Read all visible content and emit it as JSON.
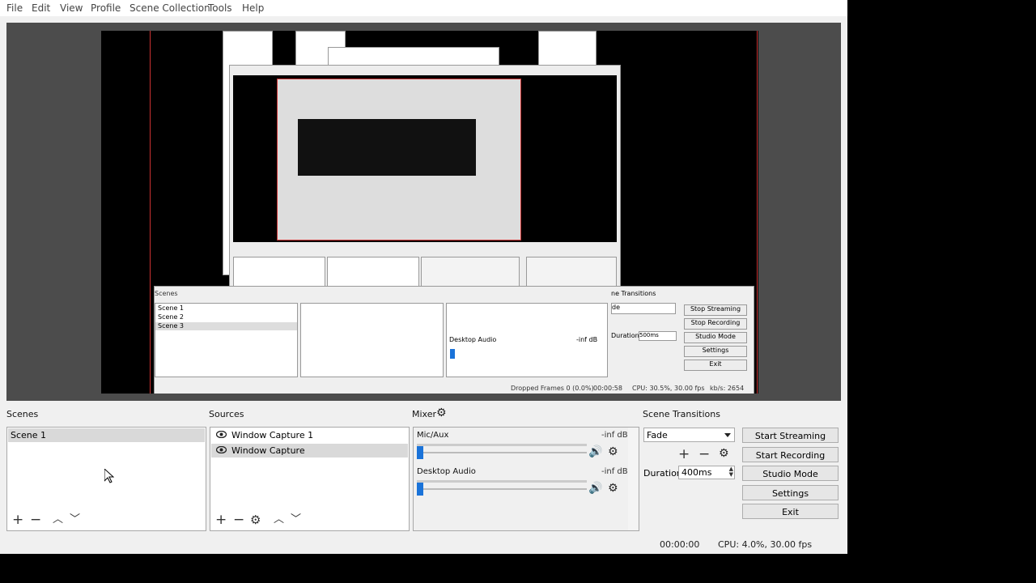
{
  "menu": [
    "File",
    "Edit",
    "View",
    "Profile",
    "Scene Collection",
    "Tools",
    "Help"
  ],
  "scenes": {
    "title": "Scenes",
    "items": [
      "Scene 1"
    ],
    "selected": "Scene 1"
  },
  "sources": {
    "title": "Sources",
    "items": [
      "Window Capture 1",
      "Window Capture"
    ]
  },
  "mixer": {
    "title": "Mixer",
    "channels": [
      {
        "name": "Mic/Aux",
        "db": "-inf dB",
        "level": 0
      },
      {
        "name": "Desktop Audio",
        "db": "-inf dB",
        "level": 0
      }
    ]
  },
  "transitions": {
    "title": "Scene Transitions",
    "selected": "Fade",
    "duration_label": "Duration",
    "duration_value": "400ms"
  },
  "controls": {
    "start_streaming": "Start Streaming",
    "start_recording": "Start Recording",
    "studio_mode": "Studio Mode",
    "settings": "Settings",
    "exit": "Exit"
  },
  "status": {
    "time": "00:00:00",
    "cpu": "CPU: 4.0%, 30.00 fps"
  },
  "preview_nested": {
    "scenes": [
      "Scene 1",
      "Scene 2",
      "Scene 3"
    ],
    "dropped": "Dropped Frames 0 (0.0%)",
    "time": "00:00:58",
    "cpu": "CPU: 30.5%, 30.00 fps",
    "kbps": "kb/s: 2654",
    "stop_streaming": "Stop Streaming",
    "stop_recording": "Stop Recording",
    "studio_mode": "Studio Mode",
    "settings": "Settings",
    "exit": "Exit",
    "desktop_audio": "Desktop Audio",
    "duration_value": "500ms",
    "transition_title": "ne Transitions",
    "transition_select": "de",
    "duration_label": "Duration",
    "scenes_title": "Scenes",
    "db": "-inf dB"
  }
}
